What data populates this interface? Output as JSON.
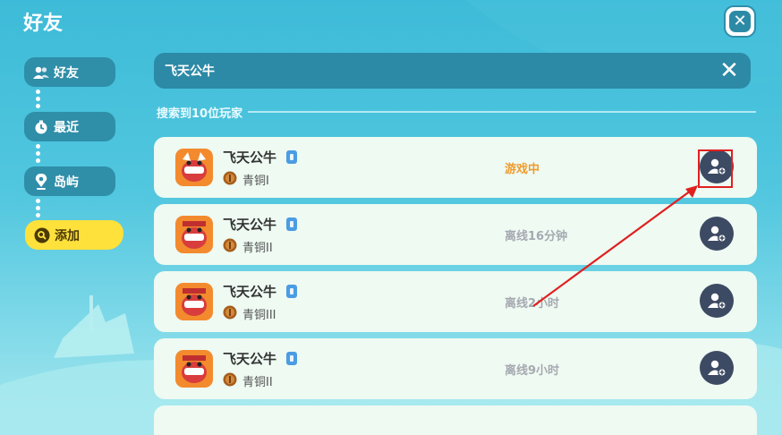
{
  "header": {
    "title": "好友",
    "close_icon": "close-icon"
  },
  "nav": {
    "items": [
      {
        "label": "好友",
        "icon": "friends-icon"
      },
      {
        "label": "最近",
        "icon": "timer-icon"
      },
      {
        "label": "岛屿",
        "icon": "location-pin-icon"
      },
      {
        "label": "添加",
        "icon": "search-icon"
      }
    ]
  },
  "search": {
    "query": "飞天公牛",
    "clear_icon": "clear-icon"
  },
  "results": {
    "label": "搜索到10位玩家",
    "players": [
      {
        "name": "飞天公牛",
        "rank": "青铜I",
        "status": "游戏中",
        "status_color": "#ef9b2e"
      },
      {
        "name": "飞天公牛",
        "rank": "青铜II",
        "status": "离线16分钟",
        "status_color": "#a7a9b1"
      },
      {
        "name": "飞天公牛",
        "rank": "青铜III",
        "status": "离线2小时",
        "status_color": "#a7a9b1"
      },
      {
        "name": "飞天公牛",
        "rank": "青铜II",
        "status": "离线9小时",
        "status_color": "#a7a9b1"
      }
    ]
  },
  "colors": {
    "accent": "#ffe13b",
    "panel": "#2c8aa6",
    "card": "#eefaf2",
    "button": "#3d4a63",
    "highlight": "#e02020"
  }
}
